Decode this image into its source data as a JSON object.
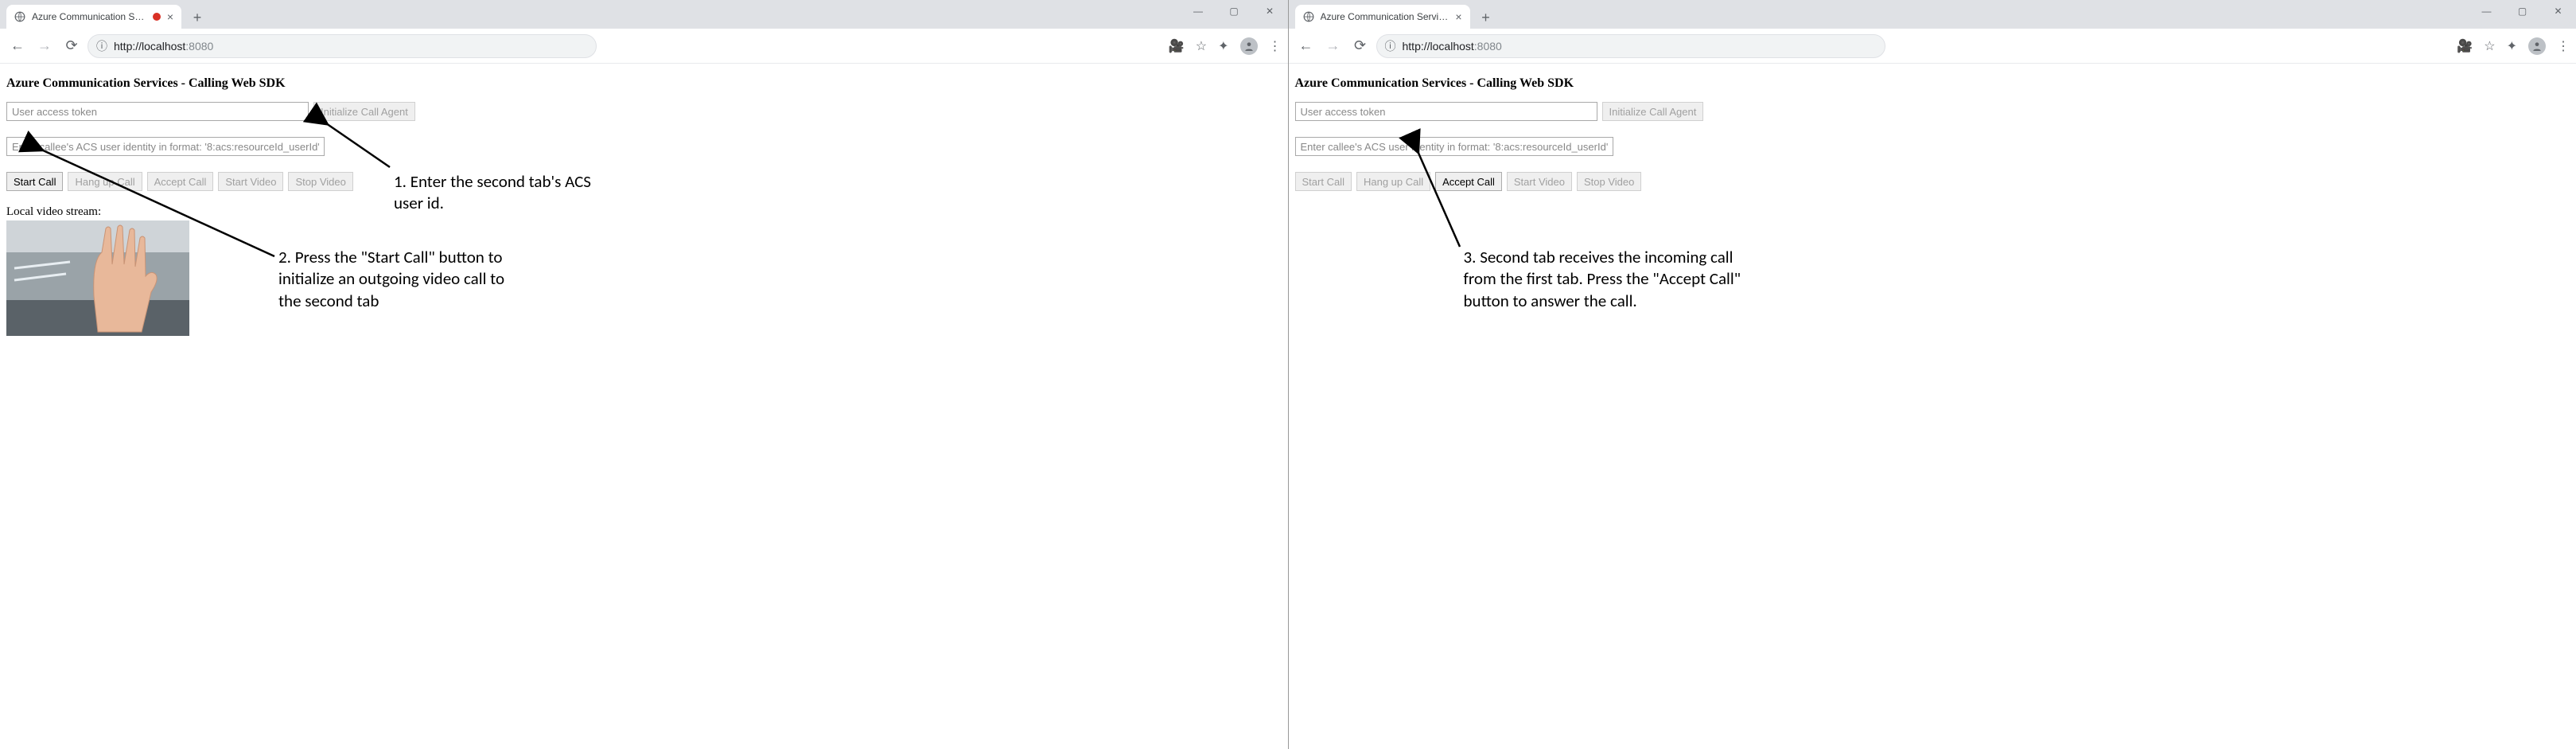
{
  "left": {
    "tab": {
      "title": "Azure Communication Servic",
      "recording": true
    },
    "url": {
      "host": "http://localhost",
      "port": ":8080"
    },
    "newTab": "+",
    "win": {
      "min": "—",
      "max": "▢",
      "close": "✕"
    },
    "addrIcons": {
      "cam": "🎥",
      "star": "☆",
      "ext": "✦",
      "menu": "⋮"
    },
    "page": {
      "heading": "Azure Communication Services - Calling Web SDK",
      "tokenPlaceholder": "User access token",
      "initBtn": "Initialize Call Agent",
      "calleePlaceholder": "Enter callee's ACS user identity in format: '8:acs:resourceId_userId'",
      "buttons": {
        "startCall": "Start Call",
        "hangUp": "Hang up Call",
        "acceptCall": "Accept Call",
        "startVideo": "Start Video",
        "stopVideo": "Stop Video"
      },
      "buttonsEnabled": {
        "startCall": true,
        "hangUp": false,
        "acceptCall": false,
        "startVideo": false,
        "stopVideo": false
      },
      "videoLabel": "Local video stream:"
    },
    "annotations": {
      "a1": "1. Enter the second tab's ACS user id.",
      "a2": "2. Press the \"Start Call\" button to initialize an outgoing video call to the second tab"
    }
  },
  "right": {
    "tab": {
      "title": "Azure Communication Services",
      "recording": false
    },
    "url": {
      "host": "http://localhost",
      "port": ":8080"
    },
    "newTab": "+",
    "win": {
      "min": "—",
      "max": "▢",
      "close": "✕"
    },
    "addrIcons": {
      "cam": "🎥",
      "star": "☆",
      "ext": "✦",
      "menu": "⋮"
    },
    "page": {
      "heading": "Azure Communication Services - Calling Web SDK",
      "tokenPlaceholder": "User access token",
      "initBtn": "Initialize Call Agent",
      "calleePlaceholder": "Enter callee's ACS user identity in format: '8:acs:resourceId_userId'",
      "buttons": {
        "startCall": "Start Call",
        "hangUp": "Hang up Call",
        "acceptCall": "Accept Call",
        "startVideo": "Start Video",
        "stopVideo": "Stop Video"
      },
      "buttonsEnabled": {
        "startCall": false,
        "hangUp": false,
        "acceptCall": true,
        "startVideo": false,
        "stopVideo": false
      }
    },
    "annotations": {
      "a3": "3. Second tab receives the incoming call from the first tab. Press the \"Accept Call\" button to answer the call."
    }
  }
}
